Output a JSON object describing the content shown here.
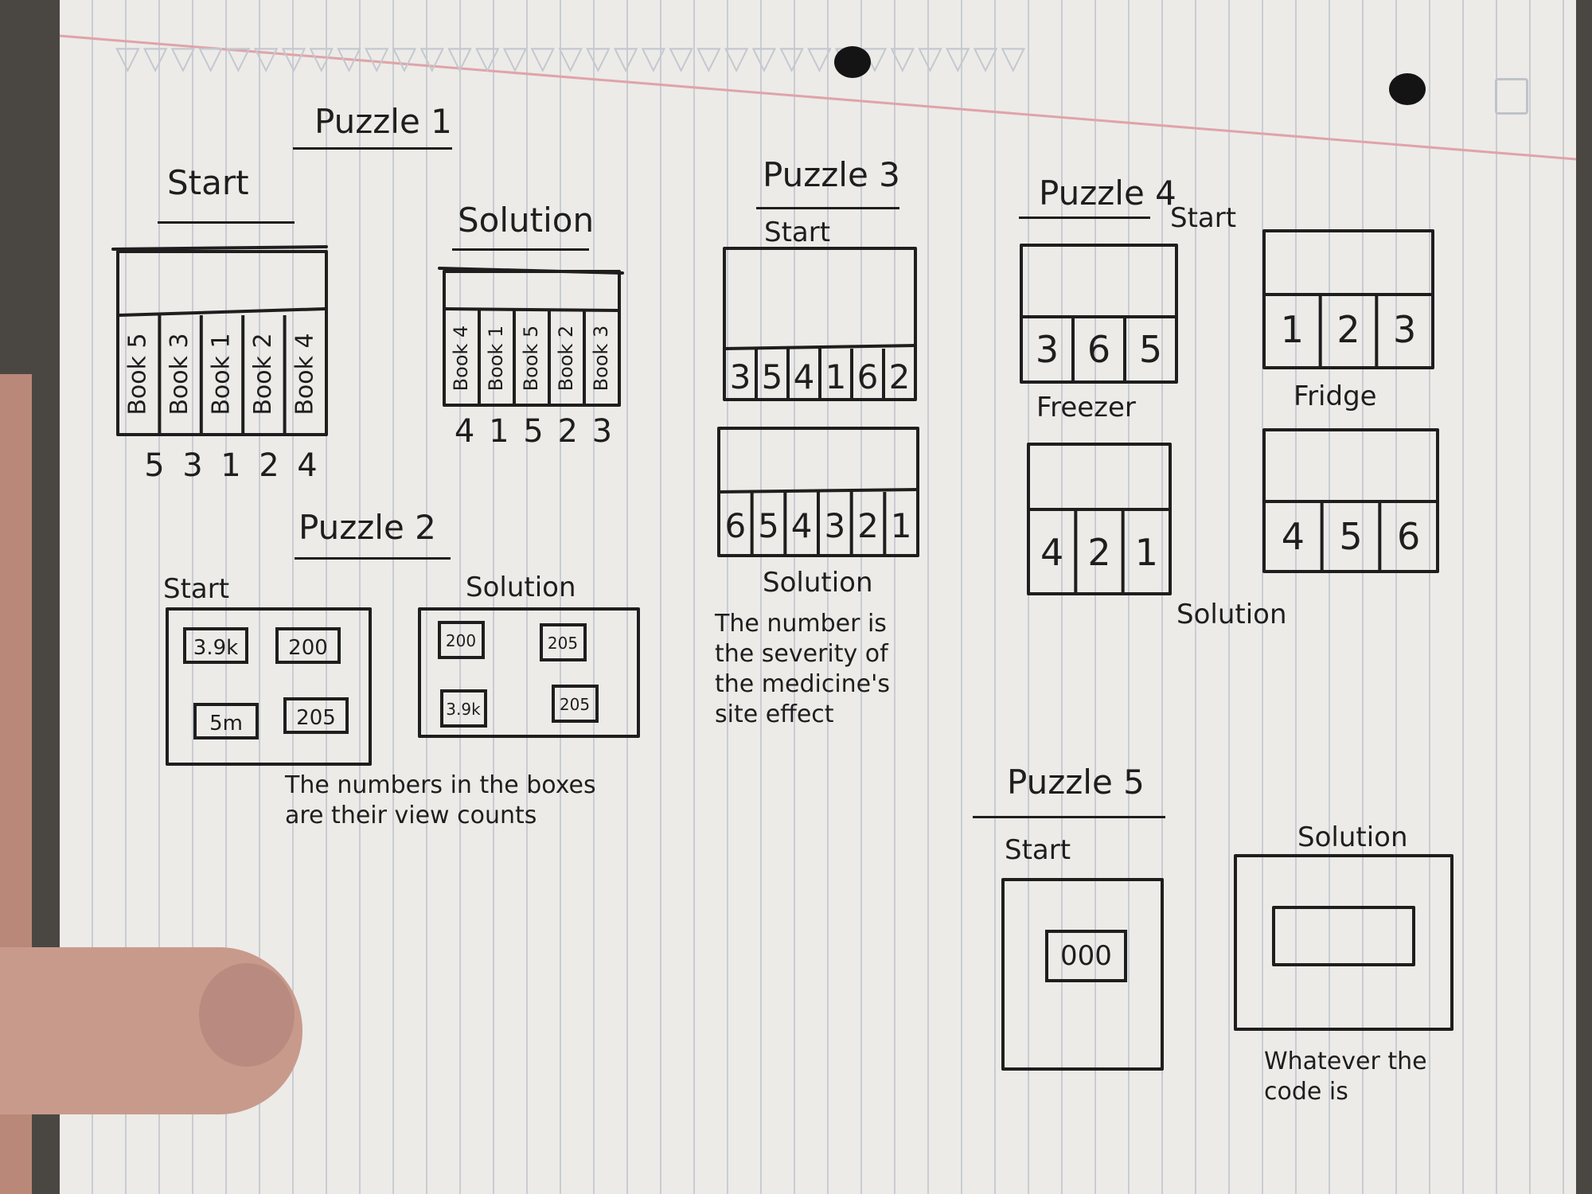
{
  "puzzle1": {
    "title": "Puzzle 1",
    "start_label": "Start",
    "solution_label": "Solution",
    "start_books": [
      "Book 5",
      "Book 3",
      "Book 1",
      "Book 2",
      "Book 4"
    ],
    "start_numbers": [
      "5",
      "3",
      "1",
      "2",
      "4"
    ],
    "solution_books": [
      "Book 4",
      "Book 1",
      "Book 5",
      "Book 2",
      "Book 3"
    ],
    "solution_numbers": [
      "4",
      "1",
      "5",
      "2",
      "3"
    ]
  },
  "puzzle2": {
    "title": "Puzzle 2",
    "start_label": "Start",
    "solution_label": "Solution",
    "start_boxes": [
      "3.9k",
      "200",
      "5m",
      "205"
    ],
    "solution_boxes": [
      "200",
      "205",
      "3.9k",
      "205"
    ],
    "note": "The numbers in the boxes are their view counts"
  },
  "puzzle3": {
    "title": "Puzzle 3",
    "start_label": "Start",
    "solution_label": "Solution",
    "start_cells": [
      "3",
      "5",
      "4",
      "1",
      "6",
      "2"
    ],
    "solution_cells": [
      "6",
      "5",
      "4",
      "3",
      "2",
      "1"
    ],
    "note": "The number is the severity of the medicine's site effect"
  },
  "puzzle4": {
    "title": "Puzzle 4",
    "start_label": "Start",
    "solution_label": "Solution",
    "freezer_label": "Freezer",
    "fridge_label": "Fridge",
    "freezer_start": [
      "3",
      "6",
      "5"
    ],
    "fridge_start": [
      "1",
      "2",
      "3"
    ],
    "freezer_solution": [
      "4",
      "2",
      "1"
    ],
    "fridge_solution": [
      "4",
      "5",
      "6"
    ]
  },
  "puzzle5": {
    "title": "Puzzle 5",
    "start_label": "Start",
    "solution_label": "Solution",
    "start_code": "000",
    "note": "Whatever the code is"
  }
}
